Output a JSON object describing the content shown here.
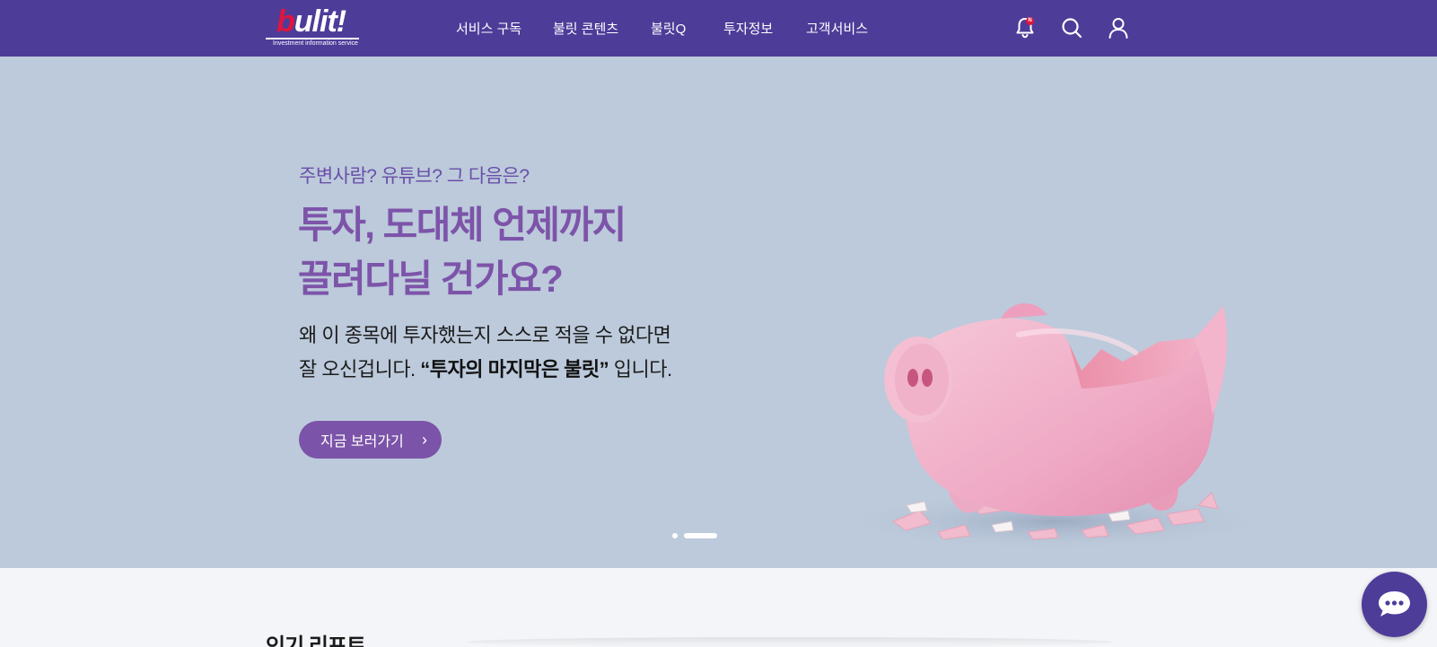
{
  "header": {
    "logo_text": "bulit!",
    "logo_tagline": "Investment information service",
    "nav": [
      {
        "label": "서비스 구독"
      },
      {
        "label": "불릿 콘텐츠"
      },
      {
        "label": "불릿Q"
      },
      {
        "label": "투자정보"
      },
      {
        "label": "고객서비스"
      }
    ],
    "notification_badge": "N",
    "icons": [
      "bell-icon",
      "search-icon",
      "user-icon"
    ]
  },
  "hero": {
    "subtitle": "주변사람? 유튜브? 그 다음은?",
    "title_line1": "투자, 도대체 언제까지",
    "title_line2": "끌려다닐 건가요?",
    "desc_line1": "왜 이 종목에 투자했는지 스스로 적을 수 없다면",
    "desc_line2_prefix": "잘 오신겁니다. ",
    "desc_line2_bold": "“투자의 마지막은 불릿”",
    "desc_line2_suffix": " 입니다.",
    "cta_label": "지금 보러가기",
    "slides": 2,
    "active_slide": 2
  },
  "section": {
    "title": "인기 리포트"
  },
  "colors": {
    "header_bg": "#4e3c99",
    "hero_bg": "#bccadb",
    "accent": "#7b53a8",
    "badge": "#e0143c"
  }
}
